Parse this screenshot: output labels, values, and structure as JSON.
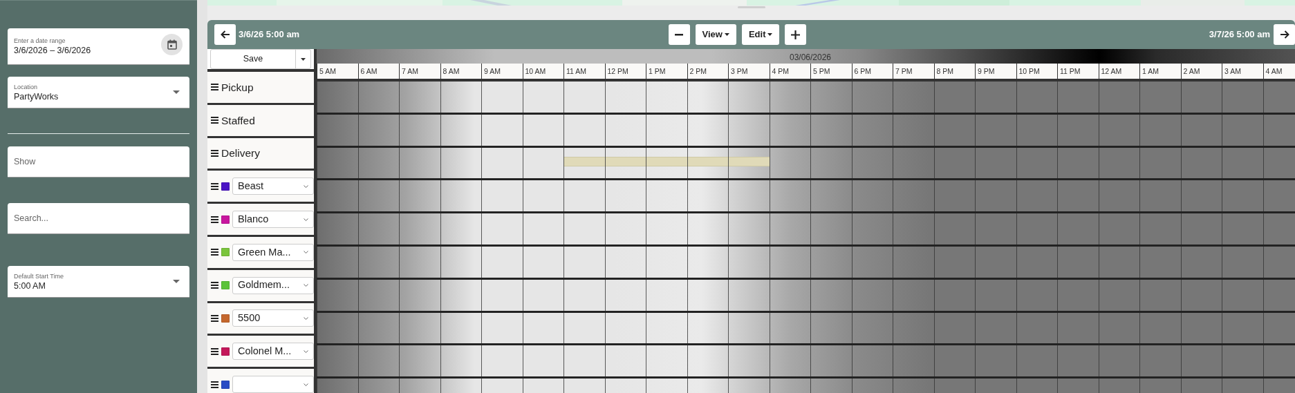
{
  "sidebar": {
    "date_range": {
      "label": "Enter a date range",
      "value": "3/6/2026 – 3/6/2026"
    },
    "location": {
      "label": "Location",
      "value": "PartyWorks"
    },
    "show": {
      "placeholder": "Show"
    },
    "search": {
      "placeholder": "Search..."
    },
    "default_start_time": {
      "label": "Default Start Time",
      "value": "5:00 AM"
    }
  },
  "toolbar": {
    "start": "3/6/26 5:00 am",
    "view": "View",
    "edit": "Edit",
    "end": "3/7/26 5:00 am"
  },
  "save_button": "Save",
  "timeline": {
    "date": "03/06/2026",
    "hours": [
      "5 AM",
      "6 AM",
      "7 AM",
      "8 AM",
      "9 AM",
      "10 AM",
      "11 AM",
      "12 PM",
      "1 PM",
      "2 PM",
      "3 PM",
      "4 PM",
      "5 PM",
      "6 PM",
      "7 PM",
      "8 PM",
      "9 PM",
      "10 PM",
      "11 PM",
      "12 AM",
      "1 AM",
      "2 AM",
      "3 AM",
      "4 AM"
    ]
  },
  "rows": [
    {
      "kind": "category",
      "name": "Pickup",
      "booked": [
        false,
        false,
        false,
        false,
        false,
        false,
        false,
        false,
        false,
        false,
        false,
        false,
        false,
        false,
        false,
        false,
        false,
        false,
        false,
        false,
        false,
        false,
        false,
        false
      ]
    },
    {
      "kind": "category",
      "name": "Staffed",
      "booked": [
        false,
        false,
        false,
        false,
        false,
        false,
        false,
        false,
        false,
        false,
        false,
        false,
        false,
        false,
        false,
        false,
        false,
        false,
        false,
        false,
        false,
        false,
        false,
        false
      ]
    },
    {
      "kind": "category",
      "name": "Delivery",
      "booked": [
        false,
        false,
        false,
        false,
        false,
        false,
        true,
        true,
        true,
        true,
        true,
        false,
        false,
        false,
        false,
        false,
        false,
        false,
        false,
        false,
        false,
        false,
        false,
        false
      ]
    },
    {
      "kind": "resource",
      "name": "Beast",
      "color": "#4b14c4",
      "booked": [
        false,
        false,
        false,
        false,
        false,
        false,
        false,
        false,
        false,
        false,
        false,
        false,
        false,
        false,
        false,
        false,
        false,
        false,
        false,
        false,
        false,
        false,
        false,
        false
      ]
    },
    {
      "kind": "resource",
      "name": "Blanco",
      "color": "#c8169e",
      "booked": [
        false,
        false,
        false,
        false,
        false,
        false,
        false,
        false,
        false,
        false,
        false,
        false,
        false,
        false,
        false,
        false,
        false,
        false,
        false,
        false,
        false,
        false,
        false,
        false
      ]
    },
    {
      "kind": "resource",
      "name": "Green Ma...",
      "color": "#7ac43c",
      "booked": [
        false,
        false,
        false,
        false,
        false,
        false,
        false,
        false,
        false,
        false,
        false,
        false,
        false,
        false,
        false,
        false,
        false,
        false,
        false,
        false,
        false,
        false,
        false,
        false
      ]
    },
    {
      "kind": "resource",
      "name": "Goldmem...",
      "color": "#5cc33a",
      "booked": [
        false,
        false,
        false,
        false,
        false,
        false,
        false,
        false,
        false,
        false,
        false,
        false,
        false,
        false,
        false,
        false,
        false,
        false,
        false,
        false,
        false,
        false,
        false,
        false
      ]
    },
    {
      "kind": "resource",
      "name": "5500",
      "color": "#c4662c",
      "booked": [
        false,
        false,
        false,
        false,
        false,
        false,
        false,
        false,
        false,
        false,
        false,
        false,
        false,
        false,
        false,
        false,
        false,
        false,
        false,
        false,
        false,
        false,
        false,
        false
      ]
    },
    {
      "kind": "resource",
      "name": "Colonel M...",
      "color": "#c4185a",
      "booked": [
        false,
        false,
        false,
        false,
        false,
        false,
        false,
        false,
        false,
        false,
        false,
        false,
        false,
        false,
        false,
        false,
        false,
        false,
        false,
        false,
        false,
        false,
        false,
        false
      ]
    },
    {
      "kind": "resource",
      "color": "#2a4cc4",
      "booked": [
        false,
        false,
        false,
        false,
        false,
        false,
        false,
        false,
        false,
        false,
        false,
        false,
        false,
        false,
        false,
        false,
        false,
        false,
        false,
        false,
        false,
        false,
        false,
        false
      ]
    }
  ]
}
